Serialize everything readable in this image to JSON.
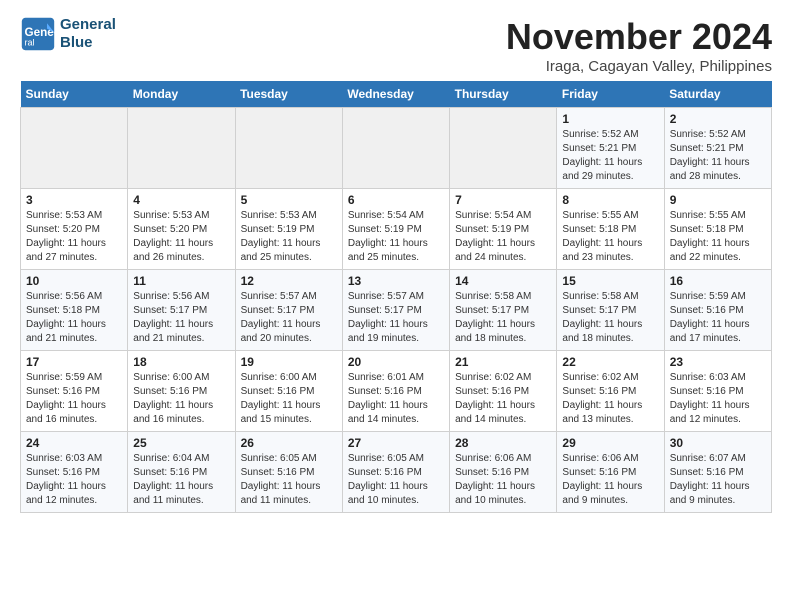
{
  "logo": {
    "line1": "General",
    "line2": "Blue"
  },
  "title": "November 2024",
  "location": "Iraga, Cagayan Valley, Philippines",
  "weekdays": [
    "Sunday",
    "Monday",
    "Tuesday",
    "Wednesday",
    "Thursday",
    "Friday",
    "Saturday"
  ],
  "weeks": [
    [
      {
        "day": "",
        "info": ""
      },
      {
        "day": "",
        "info": ""
      },
      {
        "day": "",
        "info": ""
      },
      {
        "day": "",
        "info": ""
      },
      {
        "day": "",
        "info": ""
      },
      {
        "day": "1",
        "info": "Sunrise: 5:52 AM\nSunset: 5:21 PM\nDaylight: 11 hours and 29 minutes."
      },
      {
        "day": "2",
        "info": "Sunrise: 5:52 AM\nSunset: 5:21 PM\nDaylight: 11 hours and 28 minutes."
      }
    ],
    [
      {
        "day": "3",
        "info": "Sunrise: 5:53 AM\nSunset: 5:20 PM\nDaylight: 11 hours and 27 minutes."
      },
      {
        "day": "4",
        "info": "Sunrise: 5:53 AM\nSunset: 5:20 PM\nDaylight: 11 hours and 26 minutes."
      },
      {
        "day": "5",
        "info": "Sunrise: 5:53 AM\nSunset: 5:19 PM\nDaylight: 11 hours and 25 minutes."
      },
      {
        "day": "6",
        "info": "Sunrise: 5:54 AM\nSunset: 5:19 PM\nDaylight: 11 hours and 25 minutes."
      },
      {
        "day": "7",
        "info": "Sunrise: 5:54 AM\nSunset: 5:19 PM\nDaylight: 11 hours and 24 minutes."
      },
      {
        "day": "8",
        "info": "Sunrise: 5:55 AM\nSunset: 5:18 PM\nDaylight: 11 hours and 23 minutes."
      },
      {
        "day": "9",
        "info": "Sunrise: 5:55 AM\nSunset: 5:18 PM\nDaylight: 11 hours and 22 minutes."
      }
    ],
    [
      {
        "day": "10",
        "info": "Sunrise: 5:56 AM\nSunset: 5:18 PM\nDaylight: 11 hours and 21 minutes."
      },
      {
        "day": "11",
        "info": "Sunrise: 5:56 AM\nSunset: 5:17 PM\nDaylight: 11 hours and 21 minutes."
      },
      {
        "day": "12",
        "info": "Sunrise: 5:57 AM\nSunset: 5:17 PM\nDaylight: 11 hours and 20 minutes."
      },
      {
        "day": "13",
        "info": "Sunrise: 5:57 AM\nSunset: 5:17 PM\nDaylight: 11 hours and 19 minutes."
      },
      {
        "day": "14",
        "info": "Sunrise: 5:58 AM\nSunset: 5:17 PM\nDaylight: 11 hours and 18 minutes."
      },
      {
        "day": "15",
        "info": "Sunrise: 5:58 AM\nSunset: 5:17 PM\nDaylight: 11 hours and 18 minutes."
      },
      {
        "day": "16",
        "info": "Sunrise: 5:59 AM\nSunset: 5:16 PM\nDaylight: 11 hours and 17 minutes."
      }
    ],
    [
      {
        "day": "17",
        "info": "Sunrise: 5:59 AM\nSunset: 5:16 PM\nDaylight: 11 hours and 16 minutes."
      },
      {
        "day": "18",
        "info": "Sunrise: 6:00 AM\nSunset: 5:16 PM\nDaylight: 11 hours and 16 minutes."
      },
      {
        "day": "19",
        "info": "Sunrise: 6:00 AM\nSunset: 5:16 PM\nDaylight: 11 hours and 15 minutes."
      },
      {
        "day": "20",
        "info": "Sunrise: 6:01 AM\nSunset: 5:16 PM\nDaylight: 11 hours and 14 minutes."
      },
      {
        "day": "21",
        "info": "Sunrise: 6:02 AM\nSunset: 5:16 PM\nDaylight: 11 hours and 14 minutes."
      },
      {
        "day": "22",
        "info": "Sunrise: 6:02 AM\nSunset: 5:16 PM\nDaylight: 11 hours and 13 minutes."
      },
      {
        "day": "23",
        "info": "Sunrise: 6:03 AM\nSunset: 5:16 PM\nDaylight: 11 hours and 12 minutes."
      }
    ],
    [
      {
        "day": "24",
        "info": "Sunrise: 6:03 AM\nSunset: 5:16 PM\nDaylight: 11 hours and 12 minutes."
      },
      {
        "day": "25",
        "info": "Sunrise: 6:04 AM\nSunset: 5:16 PM\nDaylight: 11 hours and 11 minutes."
      },
      {
        "day": "26",
        "info": "Sunrise: 6:05 AM\nSunset: 5:16 PM\nDaylight: 11 hours and 11 minutes."
      },
      {
        "day": "27",
        "info": "Sunrise: 6:05 AM\nSunset: 5:16 PM\nDaylight: 11 hours and 10 minutes."
      },
      {
        "day": "28",
        "info": "Sunrise: 6:06 AM\nSunset: 5:16 PM\nDaylight: 11 hours and 10 minutes."
      },
      {
        "day": "29",
        "info": "Sunrise: 6:06 AM\nSunset: 5:16 PM\nDaylight: 11 hours and 9 minutes."
      },
      {
        "day": "30",
        "info": "Sunrise: 6:07 AM\nSunset: 5:16 PM\nDaylight: 11 hours and 9 minutes."
      }
    ]
  ]
}
